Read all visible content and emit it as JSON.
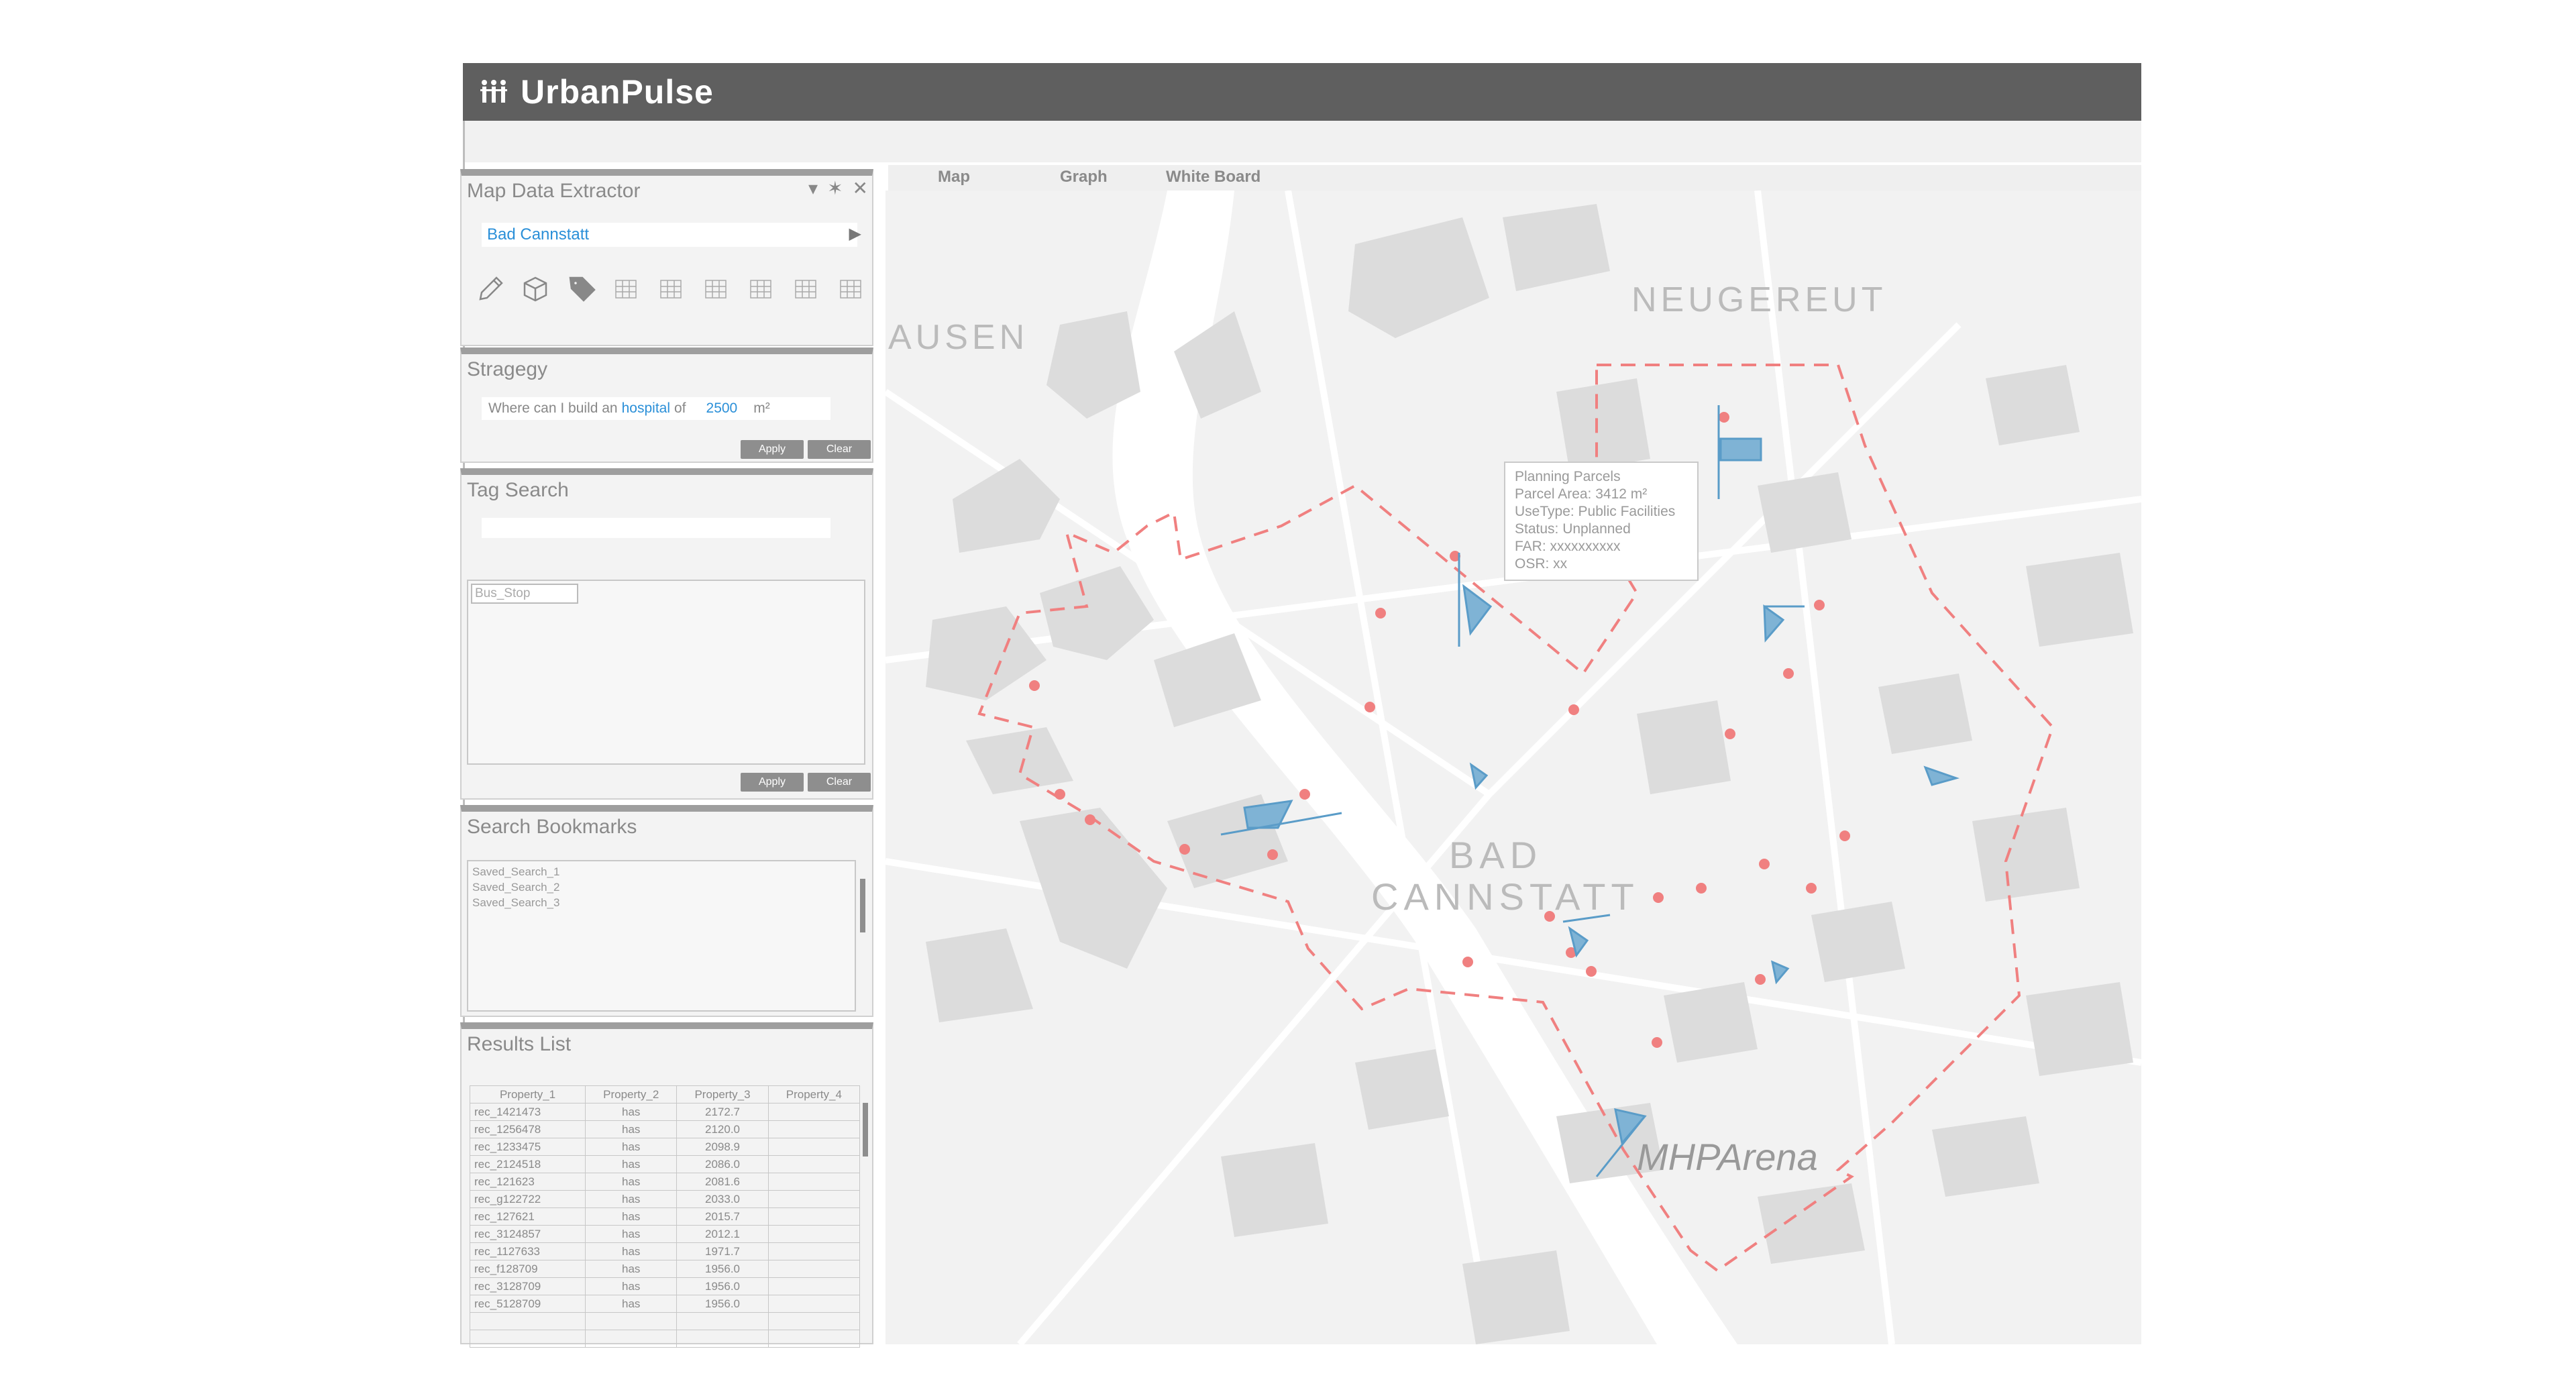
{
  "app": {
    "title": "UrbanPulse",
    "logo_icon": "people-icon"
  },
  "tabs": [
    {
      "label": "Map"
    },
    {
      "label": "Graph"
    },
    {
      "label": "White Board"
    }
  ],
  "map_extractor": {
    "title": "Map Data Extractor",
    "search_value": "Bad Cannstatt",
    "tools": [
      "pencil-icon",
      "cube-icon",
      "tag-icon",
      "grid-icon",
      "grid-icon",
      "grid-icon",
      "grid-icon",
      "grid-icon",
      "grid-icon"
    ]
  },
  "strategy": {
    "title": "Stragegy",
    "query_prefix": "Where can I build an",
    "query_facility": "hospital",
    "query_of": "of",
    "query_area": "2500",
    "query_unit": "m²",
    "apply_label": "Apply",
    "clear_label": "Clear"
  },
  "tag_search": {
    "title": "Tag Search",
    "tag": "Bus_Stop",
    "apply_label": "Apply",
    "clear_label": "Clear"
  },
  "bookmarks": {
    "title": "Search Bookmarks",
    "items": [
      "Saved_Search_1",
      "Saved_Search_2",
      "Saved_Search_3"
    ]
  },
  "results": {
    "title": "Results List",
    "columns": [
      "Property_1",
      "Property_2",
      "Property_3",
      "Property_4"
    ],
    "rows": [
      [
        "rec_1421473",
        "has",
        "2172.7",
        ""
      ],
      [
        "rec_1256478",
        "has",
        "2120.0",
        ""
      ],
      [
        "rec_1233475",
        "has",
        "2098.9",
        ""
      ],
      [
        "rec_2124518",
        "has",
        "2086.0",
        ""
      ],
      [
        "rec_121623",
        "has",
        "2081.6",
        ""
      ],
      [
        "rec_g122722",
        "has",
        "2033.0",
        ""
      ],
      [
        "rec_127621",
        "has",
        "2015.7",
        ""
      ],
      [
        "rec_3124857",
        "has",
        "2012.1",
        ""
      ],
      [
        "rec_1127633",
        "has",
        "1971.7",
        ""
      ],
      [
        "rec_f128709",
        "has",
        "1956.0",
        ""
      ],
      [
        "rec_3128709",
        "has",
        "1956.0",
        ""
      ],
      [
        "rec_5128709",
        "has",
        "1956.0",
        ""
      ],
      [
        "",
        "",
        "",
        ""
      ],
      [
        "",
        "",
        "",
        ""
      ]
    ]
  },
  "map": {
    "labels": {
      "neugereut": "NEUGEREUT",
      "ausen": "AUSEN",
      "bad": "BAD",
      "cannstatt": "CANNSTATT",
      "arena": "MHPArena"
    },
    "boundary_color": "#f08080",
    "parcel_color": "#7fb3d5"
  },
  "tooltip": {
    "title": "Planning Parcels",
    "area": "Parcel Area: 3412 m²",
    "use": "UseType: Public Facilities",
    "status": "Status: Unplanned",
    "far": "FAR: xxxxxxxxxx",
    "osr": "OSR: xx"
  }
}
